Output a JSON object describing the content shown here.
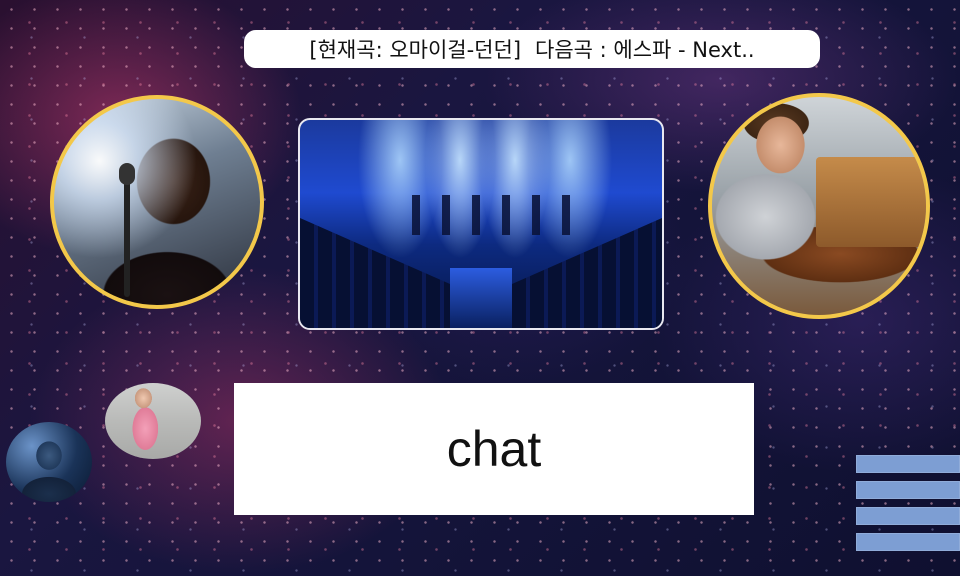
{
  "now_playing": {
    "current": "[현재곡: 오마이걸-던던]",
    "next": "다음곡 : 에스파 - Next.."
  },
  "chat": {
    "label": "chat"
  },
  "images": {
    "singer_left": "singer-with-microphone",
    "stage": "concert-stage-blue-lights",
    "guitarist": "singer-playing-guitar",
    "small_guitar": "girl-with-pink-guitar",
    "small_mic": "performer-with-microphone"
  },
  "colors": {
    "accent_border": "#f3c84a",
    "menu_bars": "#7d9ed3"
  }
}
